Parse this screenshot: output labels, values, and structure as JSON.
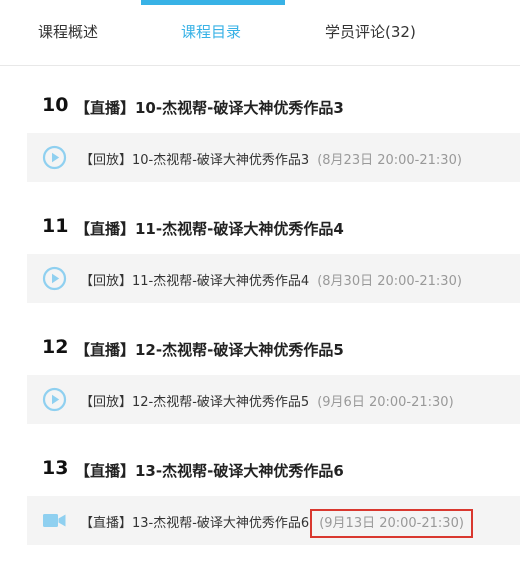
{
  "tabs": [
    {
      "label": "课程概述"
    },
    {
      "label": "课程目录"
    },
    {
      "label": "学员评论(32)"
    }
  ],
  "chapters": [
    {
      "number": "10",
      "title": "【直播】10-杰视帮-破译大神优秀作品3",
      "lesson": {
        "text": "【回放】10-杰视帮-破译大神优秀作品3",
        "time": "(8月23日 20:00-21:30)",
        "icon": "play-circle-icon"
      }
    },
    {
      "number": "11",
      "title": "【直播】11-杰视帮-破译大神优秀作品4",
      "lesson": {
        "text": "【回放】11-杰视帮-破译大神优秀作品4",
        "time": "(8月30日 20:00-21:30)",
        "icon": "play-circle-icon"
      }
    },
    {
      "number": "12",
      "title": "【直播】12-杰视帮-破译大神优秀作品5",
      "lesson": {
        "text": "【回放】12-杰视帮-破译大神优秀作品5",
        "time": "(9月6日 20:00-21:30)",
        "icon": "play-circle-icon"
      }
    },
    {
      "number": "13",
      "title": "【直播】13-杰视帮-破译大神优秀作品6",
      "lesson": {
        "text": "【直播】13-杰视帮-破译大神优秀作品6",
        "time": "(9月13日 20:00-21:30)",
        "icon": "video-camera-icon"
      }
    }
  ],
  "colors": {
    "accent": "#38b2e6",
    "icon": "#8fd0f0",
    "highlight_box": "#d9382f"
  }
}
